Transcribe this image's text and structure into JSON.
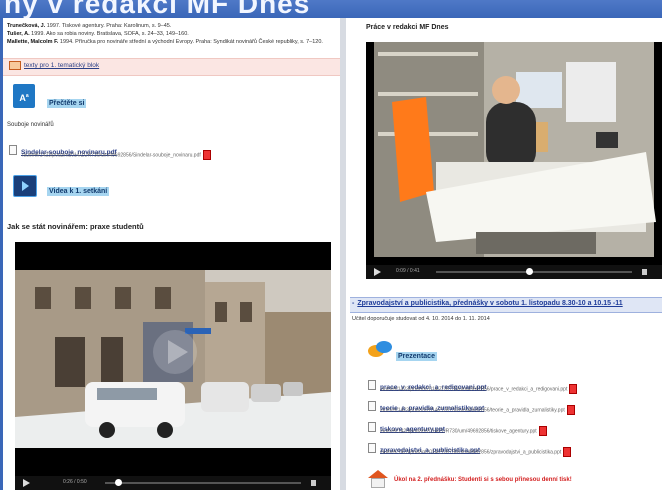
{
  "banner": {
    "text": "ný v redakci MF Dnes"
  },
  "left": {
    "refs": [
      {
        "author": "Trunečková, J.",
        "rest": " 1997. Tiskové agentury. Praha: Karolinum, s. 9–45."
      },
      {
        "author": "Tušer, A.",
        "rest": " 1999. Ako sa robia noviny. Bratislava, SOFA, s. 24–33, 149–160."
      },
      {
        "author": "Mallette, Malcolm F.",
        "rest": " 1994. Příručka pro novináře střední a východní Evropy. Praha: Syndikát novinářů České republiky, s. 7–120."
      }
    ],
    "texts_link": "texty pro 1. tematický blok",
    "read_label": "Přečtěte si",
    "duels_text": "Souboje novinářů",
    "pdf_link": "Sindelar-souboje_novinaru.pdf",
    "pdf_path": "/auth/el/1423/podzim2014/ZUR730/um/49692856/Sindelar-souboje_novinaru.pdf",
    "video_label": "Videa k 1. setkání",
    "heading": "Jak se stát novinářem: praxe studentů",
    "player_time": "0:26 / 0:50"
  },
  "right": {
    "video_title": "Práce v redakci MF Dnes",
    "player_time": "0:09 / 0:41",
    "section_title": "Zpravodajství a publicistika, přednášky v sobotu 1. listopadu 8.30-10 a 10.15 -11",
    "section_subtitle": "Učitel doporučuje studovat od 4. 10. 2014 do 1. 11. 2014",
    "presentations_label": "Prezentace",
    "files": [
      {
        "name": "prace_v_redakci_a_redigovani.ppt",
        "path": "/auth/el/1423/podzim2014/ZUR730/um/49692856/prace_v_redakci_a_redigovani.ppt"
      },
      {
        "name": "teorie_a_pravidla_zurnalistiky.ppt",
        "path": "/auth/el/1423/podzim2014/ZUR730/um/49692856/teorie_a_pravidla_zurnalistiky.ppt"
      },
      {
        "name": "tiskove_agentury.ppt",
        "path": "/auth/el/1423/podzim2014/ZUR730/um/49692856/tiskove_agentury.ppt"
      },
      {
        "name": "zpravodajstvi_a_publicistika.ppt",
        "path": "/auth/el/1423/podzim2014/ZUR730/um/49692856/zpravodajstvi_a_publicistika.ppt"
      }
    ],
    "task_text": "Úkol na 2. přednášku: Studenti si s sebou přinesou denní tisk!"
  }
}
